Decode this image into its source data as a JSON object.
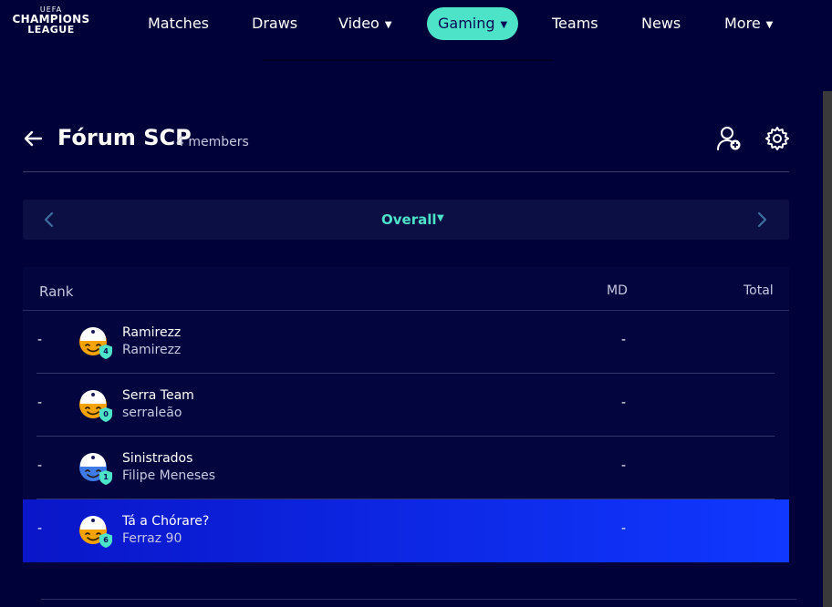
{
  "nav": {
    "logo": {
      "line1": "UEFA",
      "line2": "CHAMPIONS",
      "line3": "LEAGUE"
    },
    "items": [
      {
        "label": "Matches",
        "dropdown": false,
        "active": false
      },
      {
        "label": "Draws",
        "dropdown": false,
        "active": false
      },
      {
        "label": "Video",
        "dropdown": true,
        "active": false
      },
      {
        "label": "Gaming",
        "dropdown": true,
        "active": true
      },
      {
        "label": "Teams",
        "dropdown": false,
        "active": false
      },
      {
        "label": "News",
        "dropdown": false,
        "active": false
      },
      {
        "label": "More",
        "dropdown": true,
        "active": false
      }
    ],
    "caret": "▼"
  },
  "header": {
    "title": "Fórum SCP",
    "members": "4 members",
    "icons": {
      "back": "arrow-left-icon",
      "add": "add-user-icon",
      "settings": "gear-icon"
    }
  },
  "selector": {
    "label": "Overall",
    "caret": "▼"
  },
  "table": {
    "columns": {
      "rank": "Rank",
      "md": "MD",
      "total": "Total"
    },
    "rows": [
      {
        "rank": "-",
        "team": "Ramirezz",
        "player": "Ramirezz",
        "badge": "4",
        "md": "-",
        "total": "",
        "avatar_color": "#f5a300",
        "highlighted": false
      },
      {
        "rank": "-",
        "team": "Serra Team",
        "player": "serraleão",
        "badge": "0",
        "md": "-",
        "total": "",
        "avatar_color": "#f5a300",
        "highlighted": false
      },
      {
        "rank": "-",
        "team": "Sinistrados",
        "player": "Filipe Meneses",
        "badge": "1",
        "md": "-",
        "total": "",
        "avatar_color": "#3f7be8",
        "highlighted": false
      },
      {
        "rank": "-",
        "team": "Tá a Chórare?",
        "player": "Ferraz 90",
        "badge": "6",
        "md": "-",
        "total": "",
        "avatar_color": "#f5a300",
        "highlighted": true
      }
    ]
  },
  "colors": {
    "background": "#01013a",
    "accent": "#4de3c8",
    "highlight": "#1038ff"
  }
}
